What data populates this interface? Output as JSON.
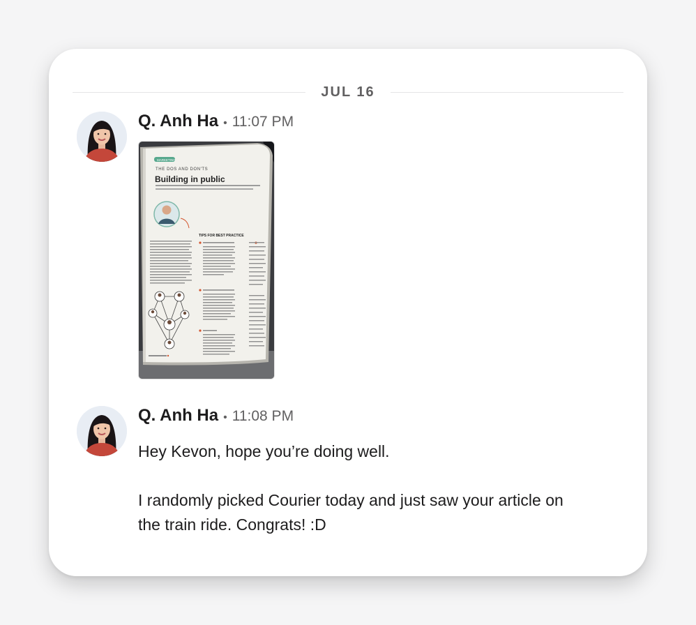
{
  "divider": {
    "date": "JUL 16"
  },
  "messages": [
    {
      "author": "Q. Anh Ha",
      "separator": "•",
      "time": "11:07 PM",
      "attachment": {
        "type": "image",
        "label": "MARKETING",
        "kicker": "THE DOS AND DON'TS",
        "title": "Building in public",
        "section_heading": "TIPS FOR BEST PRACTICE"
      }
    },
    {
      "author": "Q. Anh Ha",
      "separator": "•",
      "time": "11:08 PM",
      "paragraphs": [
        "Hey Kevon, hope you’re doing well.",
        "I randomly picked Courier today and just saw your article on the train ride. Congrats! :D"
      ]
    }
  ]
}
